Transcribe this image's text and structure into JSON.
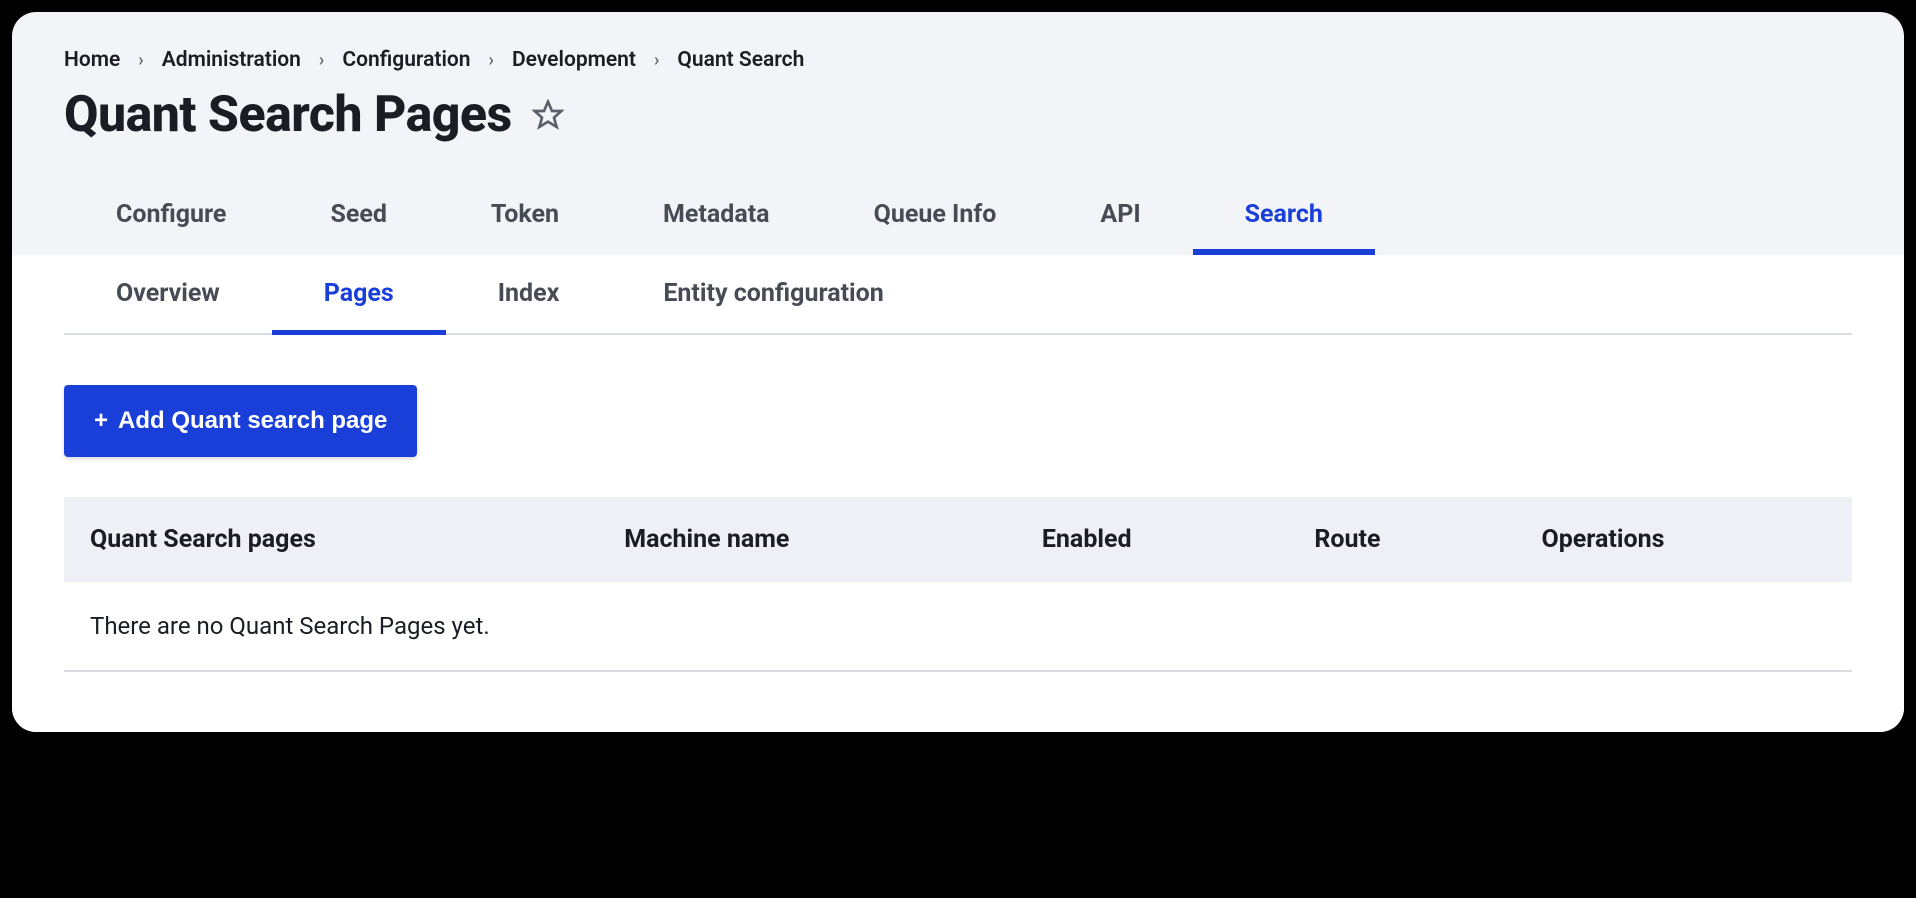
{
  "breadcrumb": {
    "items": [
      "Home",
      "Administration",
      "Configuration",
      "Development",
      "Quant Search"
    ]
  },
  "page": {
    "title": "Quant Search Pages"
  },
  "primary_tabs": {
    "items": [
      {
        "label": "Configure",
        "active": false
      },
      {
        "label": "Seed",
        "active": false
      },
      {
        "label": "Token",
        "active": false
      },
      {
        "label": "Metadata",
        "active": false
      },
      {
        "label": "Queue Info",
        "active": false
      },
      {
        "label": "API",
        "active": false
      },
      {
        "label": "Search",
        "active": true
      }
    ]
  },
  "secondary_tabs": {
    "items": [
      {
        "label": "Overview",
        "active": false
      },
      {
        "label": "Pages",
        "active": true
      },
      {
        "label": "Index",
        "active": false
      },
      {
        "label": "Entity configuration",
        "active": false
      }
    ]
  },
  "actions": {
    "add_button_label": "Add Quant search page"
  },
  "table": {
    "headers": [
      "Quant Search pages",
      "Machine name",
      "Enabled",
      "Route",
      "Operations"
    ],
    "empty_message": "There are no Quant Search Pages yet."
  }
}
